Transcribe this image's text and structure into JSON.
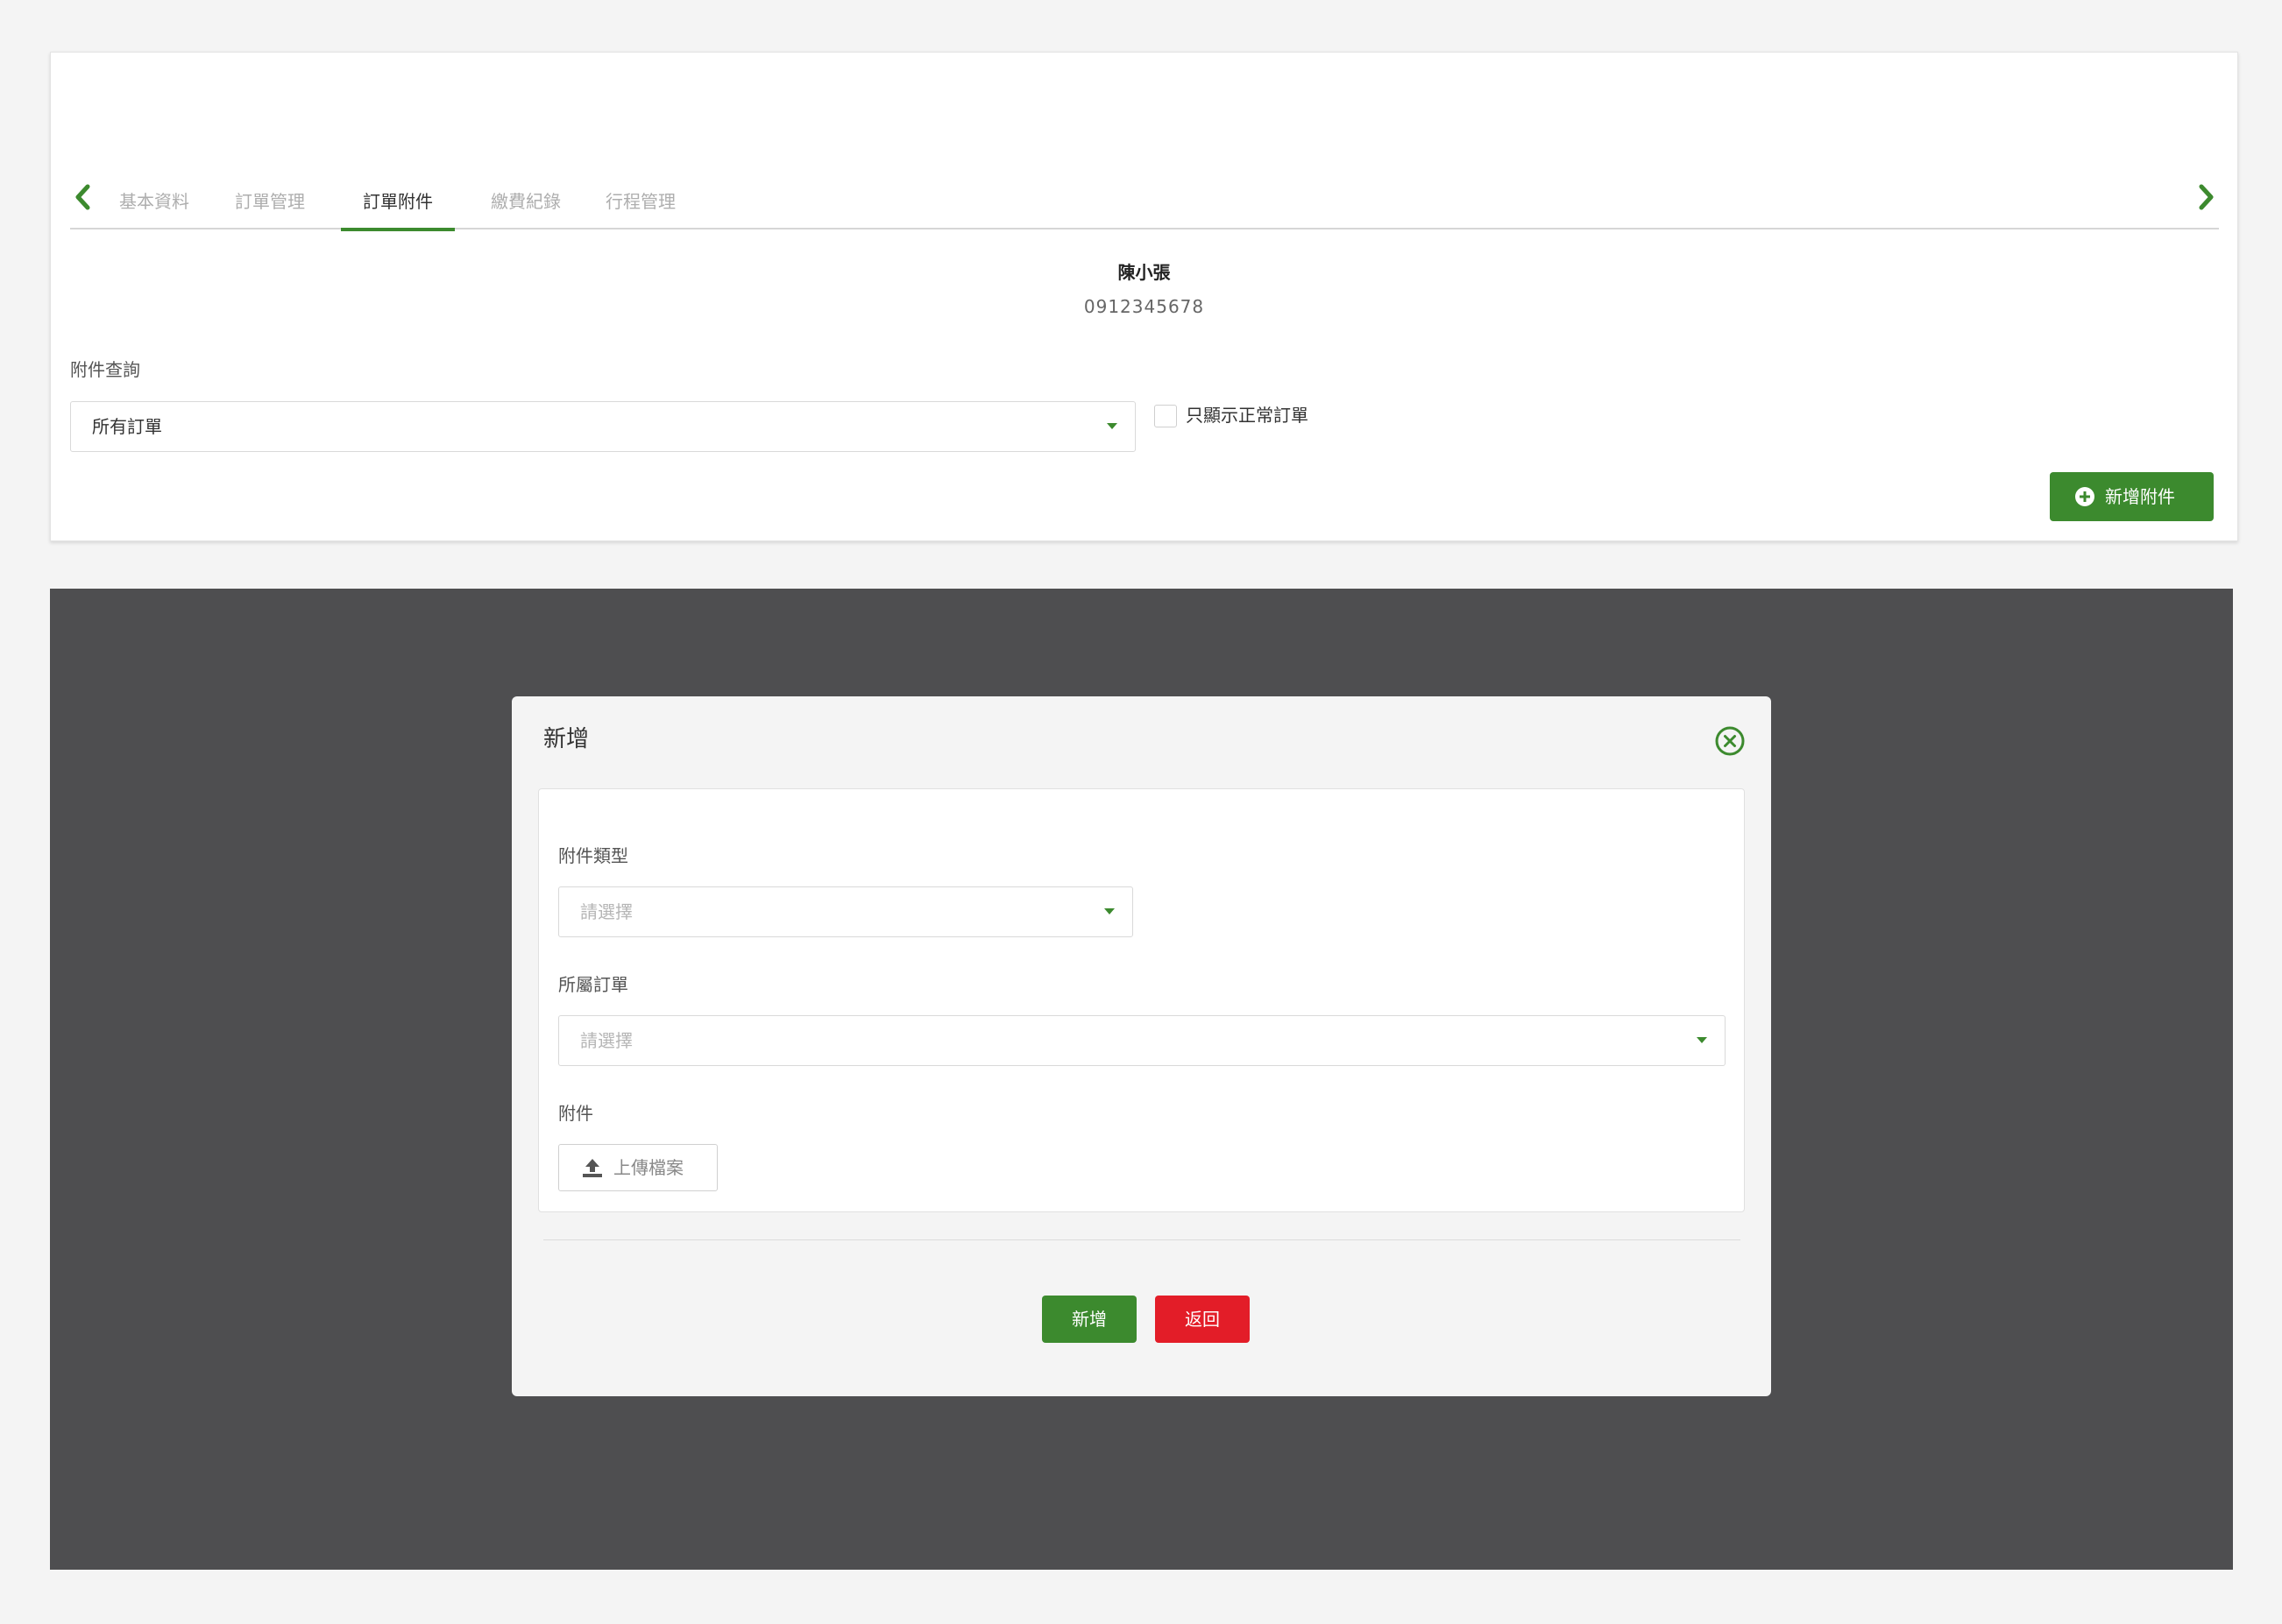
{
  "tabs": {
    "items": [
      {
        "label": "基本資料",
        "active": false
      },
      {
        "label": "訂單管理",
        "active": false
      },
      {
        "label": "訂單附件",
        "active": true
      },
      {
        "label": "繳費紀錄",
        "active": false
      },
      {
        "label": "行程管理",
        "active": false
      }
    ]
  },
  "customer": {
    "name": "陳小張",
    "phone": "0912345678"
  },
  "filter": {
    "label": "附件查詢",
    "selected": "所有訂單",
    "checkbox_label": "只顯示正常訂單",
    "checkbox_checked": false
  },
  "add_attachment_button": {
    "label": "新增附件"
  },
  "modal": {
    "title": "新增",
    "type_label": "附件類型",
    "type_placeholder": "請選擇",
    "order_label": "所屬訂單",
    "order_placeholder": "請選擇",
    "attachment_label": "附件",
    "upload_label": "上傳檔案",
    "confirm_label": "新增",
    "back_label": "返回"
  },
  "colors": {
    "primary_green": "#3c8a2e",
    "danger_red": "#e31d28",
    "overlay": "#4e4e50",
    "page_bg": "#f4f4f4"
  }
}
